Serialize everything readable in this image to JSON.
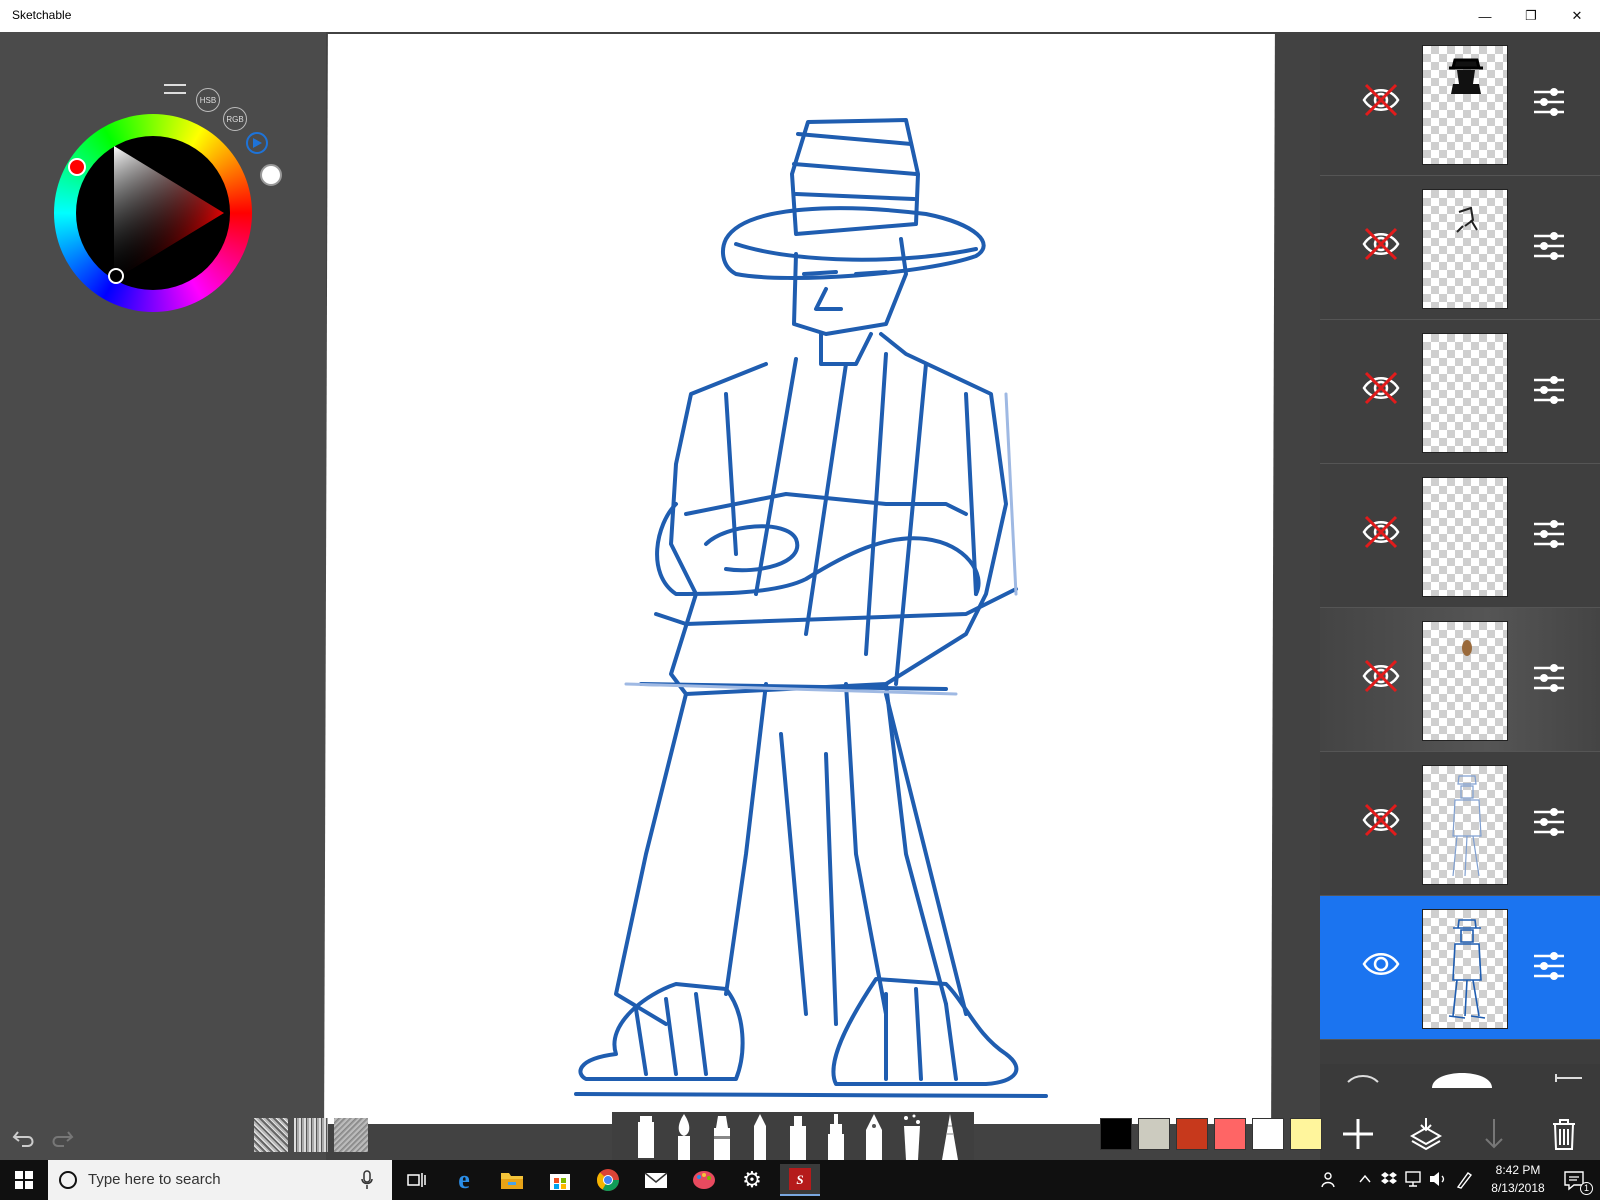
{
  "window": {
    "title": "Sketchable",
    "minimize": "—",
    "maximize": "❐",
    "close": "✕"
  },
  "color_picker": {
    "modes": [
      "HSB",
      "RGB"
    ],
    "current_color": "#ffffff",
    "hue_color": "#ff0000"
  },
  "layers": [
    {
      "visible": false,
      "selected": false,
      "thumbnail": "hat-man-silhouette"
    },
    {
      "visible": false,
      "selected": false,
      "thumbnail": "small-figure-sketch"
    },
    {
      "visible": false,
      "selected": false,
      "thumbnail": "empty"
    },
    {
      "visible": false,
      "selected": false,
      "thumbnail": "empty"
    },
    {
      "visible": false,
      "selected": false,
      "thumbnail": "brown-dab"
    },
    {
      "visible": false,
      "selected": false,
      "thumbnail": "light-blue-figure-sketch"
    },
    {
      "visible": true,
      "selected": true,
      "thumbnail": "blue-figure-sketch"
    }
  ],
  "swatches": [
    "#000000",
    "#cccbbf",
    "#c7391c",
    "#ff6565",
    "#ffffff",
    "#fff59c"
  ],
  "brushes": [
    "marker",
    "brush",
    "pen",
    "pencil",
    "highlighter",
    "airbrush",
    "ink-pen",
    "splatter",
    "eraser"
  ],
  "colors": {
    "accent": "#1b74f0",
    "stroke": "#1f5db0",
    "hidden_marker": "#e21b1b"
  },
  "taskbar": {
    "search_placeholder": "Type here to search",
    "time": "8:42 PM",
    "date": "8/13/2018",
    "notification_count": "1"
  }
}
